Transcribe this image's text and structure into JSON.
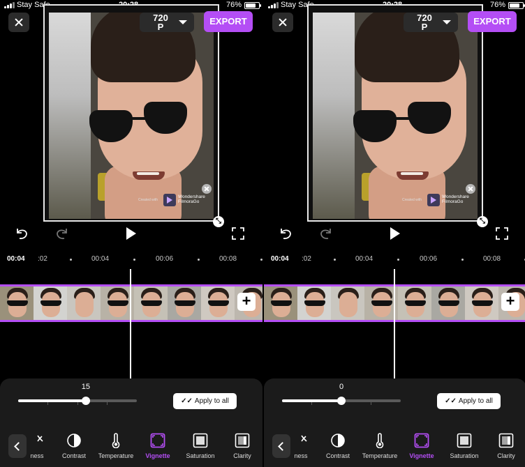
{
  "colors": {
    "accent": "#b44ef5",
    "panel": "#1b1b1b",
    "background": "#000000"
  },
  "screens": [
    {
      "status": {
        "carrier": "Stay Safe",
        "time": "20:28",
        "battery": "76%"
      },
      "resolution": "720\nP",
      "export_label": "EXPORT",
      "watermark": {
        "created_with": "Created with",
        "brand": "Wondershare\nFilmoraGo"
      },
      "ruler": {
        "current": "00:04",
        "ticks": [
          ":02",
          "00:04",
          "00:06",
          "00:08"
        ]
      },
      "slider": {
        "value": "15",
        "fraction": 0.57
      },
      "apply_all": "Apply to all",
      "tools": [
        {
          "label": "ness",
          "icon": "brightness-icon"
        },
        {
          "label": "Contrast",
          "icon": "contrast-icon"
        },
        {
          "label": "Temperature",
          "icon": "temperature-icon"
        },
        {
          "label": "Vignette",
          "icon": "vignette-icon",
          "active": true
        },
        {
          "label": "Saturation",
          "icon": "saturation-icon"
        },
        {
          "label": "Clarity",
          "icon": "clarity-icon"
        }
      ]
    },
    {
      "status": {
        "carrier": "Stay Safe",
        "time": "20:28",
        "battery": "76%"
      },
      "resolution": "720\nP",
      "export_label": "EXPORT",
      "watermark": {
        "created_with": "Created with",
        "brand": "Wondershare\nFilmoraGo"
      },
      "ruler": {
        "current": "00:04",
        "ticks": [
          ":02",
          "00:04",
          "00:06",
          "00:08"
        ]
      },
      "slider": {
        "value": "0",
        "fraction": 0.5
      },
      "apply_all": "Apply to all",
      "tools": [
        {
          "label": "ness",
          "icon": "brightness-icon"
        },
        {
          "label": "Contrast",
          "icon": "contrast-icon"
        },
        {
          "label": "Temperature",
          "icon": "temperature-icon"
        },
        {
          "label": "Vignette",
          "icon": "vignette-icon",
          "active": true
        },
        {
          "label": "Saturation",
          "icon": "saturation-icon"
        },
        {
          "label": "Clarity",
          "icon": "clarity-icon"
        }
      ]
    }
  ]
}
